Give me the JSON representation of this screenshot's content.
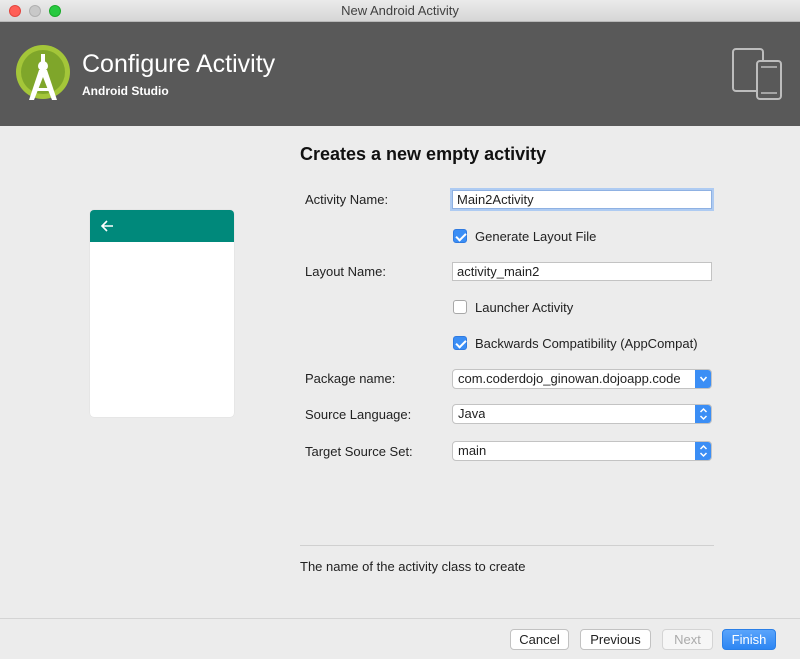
{
  "window": {
    "title": "New Android Activity"
  },
  "header": {
    "title": "Configure Activity",
    "subtitle": "Android Studio",
    "logo_icon": "android-studio-icon",
    "device_icon": "phone-tablet-icon"
  },
  "main": {
    "section_title": "Creates a new empty activity",
    "preview": {
      "icon": "back-arrow-icon",
      "accent": "#00897b"
    },
    "form": {
      "activity_name_label": "Activity Name:",
      "activity_name_value": "Main2Activity",
      "generate_layout_label": "Generate Layout File",
      "generate_layout_checked": true,
      "layout_name_label": "Layout Name:",
      "layout_name_value": "activity_main2",
      "launcher_activity_label": "Launcher Activity",
      "launcher_activity_checked": false,
      "backwards_compat_label": "Backwards Compatibility (AppCompat)",
      "backwards_compat_checked": true,
      "package_name_label": "Package name:",
      "package_name_value": "com.coderdojo_ginowan.dojoapp.code",
      "source_language_label": "Source Language:",
      "source_language_value": "Java",
      "target_source_set_label": "Target Source Set:",
      "target_source_set_value": "main"
    },
    "hint": "The name of the activity class to create"
  },
  "footer": {
    "cancel": "Cancel",
    "previous": "Previous",
    "next": "Next",
    "finish": "Finish"
  },
  "colors": {
    "header_bg": "#595959",
    "accent_blue": "#3b8ef5",
    "android_green": "#a4c639"
  }
}
